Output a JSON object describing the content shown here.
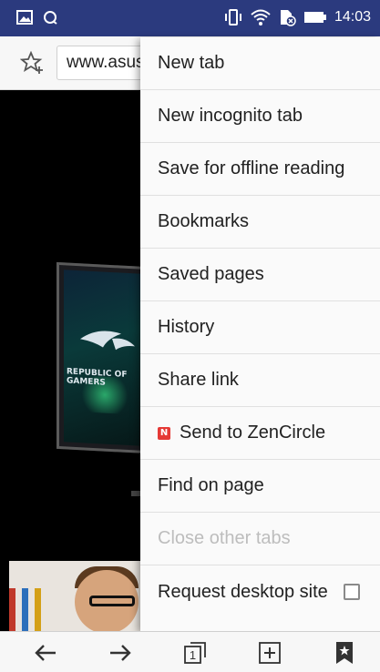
{
  "status_bar": {
    "time": "14:03",
    "left_icons": [
      "gallery-icon",
      "sync-icon"
    ],
    "right_icons": [
      "vibrate-icon",
      "wifi-icon",
      "sim-blocked-icon",
      "battery-icon"
    ]
  },
  "toolbar": {
    "url": "www.asus.com",
    "star_icon": "add-bookmark-star-icon"
  },
  "menu": {
    "items": [
      {
        "label": "New tab",
        "enabled": true
      },
      {
        "label": "New incognito tab",
        "enabled": true
      },
      {
        "label": "Save for offline reading",
        "enabled": true
      },
      {
        "label": "Bookmarks",
        "enabled": true
      },
      {
        "label": "Saved pages",
        "enabled": true
      },
      {
        "label": "History",
        "enabled": true
      },
      {
        "label": "Share link",
        "enabled": true
      },
      {
        "label": "Send to ZenCircle",
        "enabled": true,
        "badge": "N"
      },
      {
        "label": "Find on page",
        "enabled": true
      },
      {
        "label": "Close other tabs",
        "enabled": false
      },
      {
        "label": "Request desktop site",
        "enabled": true,
        "checked": false
      }
    ]
  },
  "web_content": {
    "monitor_text_line1": "REPUBLIC OF",
    "monitor_text_line2": "GAMERS"
  },
  "bottom_bar": {
    "tab_count": "1",
    "buttons": [
      "back-arrow-icon",
      "forward-arrow-icon",
      "tabs-icon",
      "add-icon",
      "bookmark-icon"
    ]
  },
  "colors": {
    "status_bar": "#2b3a7e",
    "menu_disabled": "#bdbdbd",
    "zen_badge": "#e53935"
  }
}
